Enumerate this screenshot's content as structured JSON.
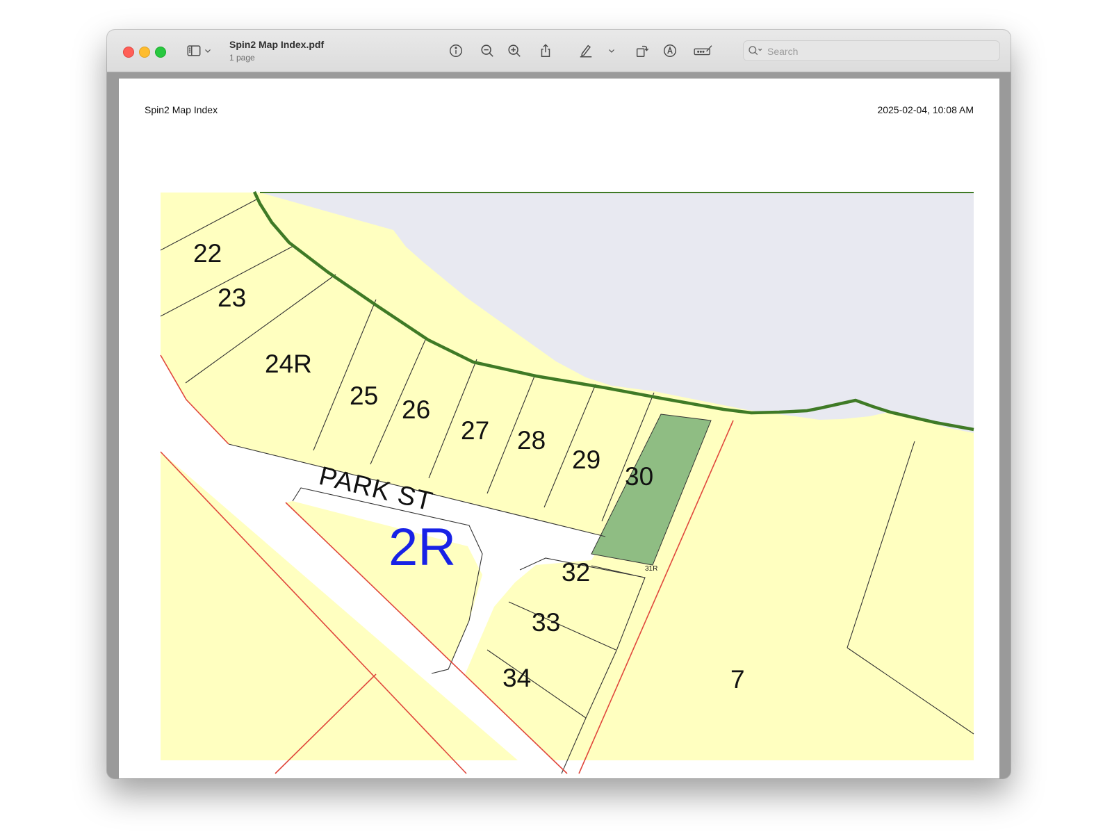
{
  "window": {
    "title": "Spin2 Map Index.pdf",
    "subtitle": "1 page"
  },
  "toolbar": {
    "icons": [
      "sidebar-icon",
      "chevron-down-icon",
      "info-icon",
      "zoom-out-icon",
      "zoom-in-icon",
      "share-icon",
      "markup-pen-icon",
      "chevron-down-icon",
      "rotate-icon",
      "annotate-icon",
      "form-fill-icon",
      "search-icon"
    ],
    "search_placeholder": "Search"
  },
  "page": {
    "header_left": "Spin2 Map Index",
    "header_right": "2025-02-04, 10:08 AM"
  },
  "map": {
    "colors": {
      "lot_fill": "#ffffc0",
      "water_fill": "#e8e9f1",
      "shoreline": "#3f7a26",
      "highlight_lot": "#8fbd83",
      "road_boundary": "#e0473c",
      "block_label": "#1822e6"
    },
    "street_label": "PARK ST",
    "block_label": "2R",
    "highlighted_lot": "30",
    "lots": [
      "22",
      "23",
      "24R",
      "25",
      "26",
      "27",
      "28",
      "29",
      "30",
      "31R",
      "32",
      "33",
      "34",
      "7"
    ]
  }
}
